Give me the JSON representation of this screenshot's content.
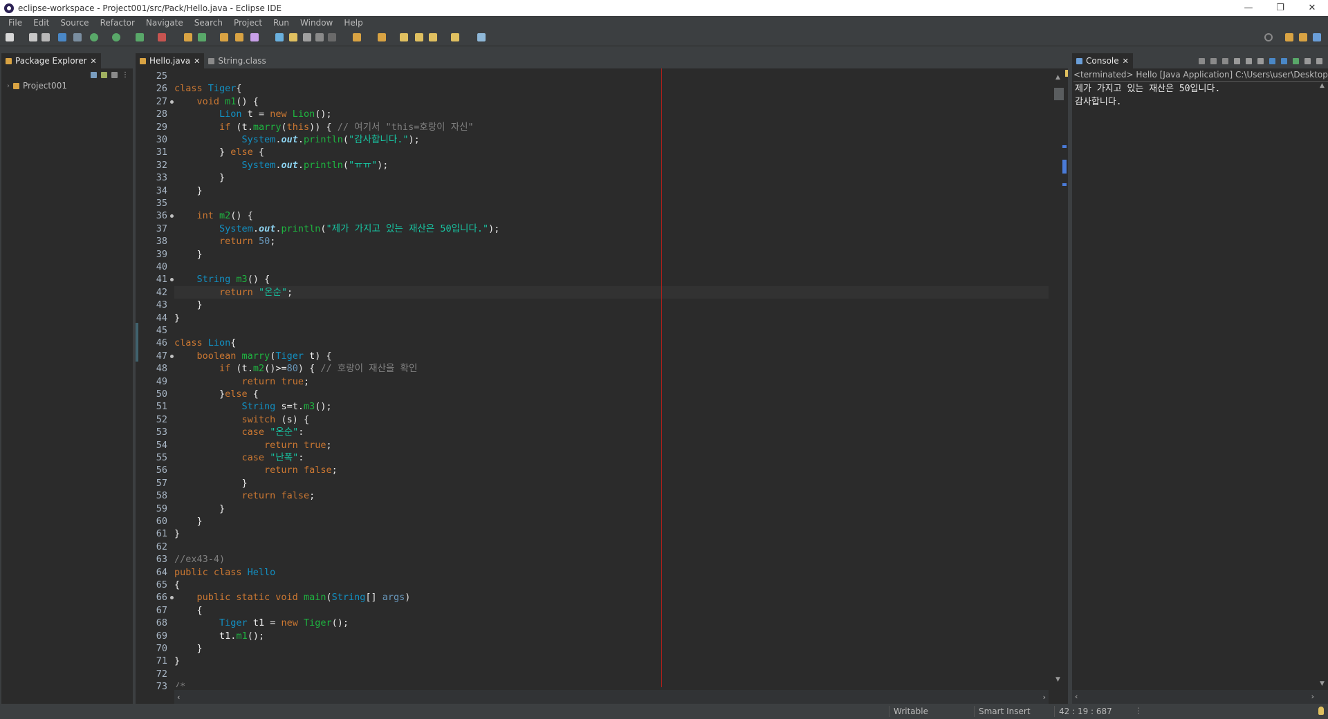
{
  "window": {
    "title": "eclipse-workspace - Project001/src/Pack/Hello.java - Eclipse IDE",
    "minimize": "—",
    "restore": "❐",
    "close": "✕"
  },
  "menu": [
    "File",
    "Edit",
    "Source",
    "Refactor",
    "Navigate",
    "Search",
    "Project",
    "Run",
    "Window",
    "Help"
  ],
  "package_explorer": {
    "tab_label": "Package Explorer",
    "tree": [
      {
        "label": "Project001",
        "expanded": false
      }
    ]
  },
  "editor": {
    "tabs": [
      {
        "label": "Hello.java",
        "active": true
      },
      {
        "label": "String.class",
        "active": false
      }
    ],
    "current_line": 42,
    "folded_markers": [
      27,
      36,
      41,
      47,
      66
    ],
    "lines": [
      {
        "n": 25,
        "tokens": []
      },
      {
        "n": 26,
        "tokens": [
          [
            "kw",
            "class "
          ],
          [
            "ty",
            "Tiger"
          ],
          [
            "pl",
            "{"
          ]
        ]
      },
      {
        "n": 27,
        "tokens": [
          [
            "pl",
            "    "
          ],
          [
            "kw",
            "void "
          ],
          [
            "fn",
            "m1"
          ],
          [
            "pl",
            "() {"
          ]
        ]
      },
      {
        "n": 28,
        "tokens": [
          [
            "pl",
            "        "
          ],
          [
            "ty",
            "Lion "
          ],
          [
            "id",
            "t"
          ],
          [
            "pl",
            " = "
          ],
          [
            "kw",
            "new "
          ],
          [
            "fn",
            "Lion"
          ],
          [
            "pl",
            "();"
          ]
        ]
      },
      {
        "n": 29,
        "tokens": [
          [
            "pl",
            "        "
          ],
          [
            "kw",
            "if "
          ],
          [
            "pl",
            "("
          ],
          [
            "id",
            "t"
          ],
          [
            "pl",
            "."
          ],
          [
            "fn",
            "marry"
          ],
          [
            "pl",
            "("
          ],
          [
            "kw",
            "this"
          ],
          [
            "pl",
            ")) { "
          ],
          [
            "cm",
            "// 여기서 \"this=호랑이 자신\""
          ]
        ]
      },
      {
        "n": 30,
        "tokens": [
          [
            "pl",
            "            "
          ],
          [
            "ty",
            "System"
          ],
          [
            "pl",
            "."
          ],
          [
            "fl",
            "out"
          ],
          [
            "pl",
            "."
          ],
          [
            "fn",
            "println"
          ],
          [
            "pl",
            "("
          ],
          [
            "st",
            "\"감사합니다.\""
          ],
          [
            "pl",
            ");"
          ]
        ]
      },
      {
        "n": 31,
        "tokens": [
          [
            "pl",
            "        } "
          ],
          [
            "kw",
            "else "
          ],
          [
            "pl",
            "{"
          ]
        ]
      },
      {
        "n": 32,
        "tokens": [
          [
            "pl",
            "            "
          ],
          [
            "ty",
            "System"
          ],
          [
            "pl",
            "."
          ],
          [
            "fl",
            "out"
          ],
          [
            "pl",
            "."
          ],
          [
            "fn",
            "println"
          ],
          [
            "pl",
            "("
          ],
          [
            "st",
            "\"ㅠㅠ\""
          ],
          [
            "pl",
            ");"
          ]
        ]
      },
      {
        "n": 33,
        "tokens": [
          [
            "pl",
            "        }"
          ]
        ]
      },
      {
        "n": 34,
        "tokens": [
          [
            "pl",
            "    }"
          ]
        ]
      },
      {
        "n": 35,
        "tokens": []
      },
      {
        "n": 36,
        "tokens": [
          [
            "pl",
            "    "
          ],
          [
            "kw",
            "int "
          ],
          [
            "fn",
            "m2"
          ],
          [
            "pl",
            "() {"
          ]
        ]
      },
      {
        "n": 37,
        "tokens": [
          [
            "pl",
            "        "
          ],
          [
            "ty",
            "System"
          ],
          [
            "pl",
            "."
          ],
          [
            "fl",
            "out"
          ],
          [
            "pl",
            "."
          ],
          [
            "fn",
            "println"
          ],
          [
            "pl",
            "("
          ],
          [
            "st",
            "\"제가 가지고 있는 재산은 50입니다.\""
          ],
          [
            "pl",
            ");"
          ]
        ]
      },
      {
        "n": 38,
        "tokens": [
          [
            "pl",
            "        "
          ],
          [
            "kw",
            "return "
          ],
          [
            "nm",
            "50"
          ],
          [
            "pl",
            ";"
          ]
        ]
      },
      {
        "n": 39,
        "tokens": [
          [
            "pl",
            "    }"
          ]
        ]
      },
      {
        "n": 40,
        "tokens": []
      },
      {
        "n": 41,
        "tokens": [
          [
            "pl",
            "    "
          ],
          [
            "ty",
            "String "
          ],
          [
            "fn",
            "m3"
          ],
          [
            "pl",
            "() {"
          ]
        ]
      },
      {
        "n": 42,
        "tokens": [
          [
            "pl",
            "        "
          ],
          [
            "kw",
            "return "
          ],
          [
            "st",
            "\"온순\""
          ],
          [
            "pl",
            ";"
          ]
        ]
      },
      {
        "n": 43,
        "tokens": [
          [
            "pl",
            "    }"
          ]
        ]
      },
      {
        "n": 44,
        "tokens": [
          [
            "pl",
            "}"
          ]
        ]
      },
      {
        "n": 45,
        "tokens": []
      },
      {
        "n": 46,
        "tokens": [
          [
            "kw",
            "class "
          ],
          [
            "ty",
            "Lion"
          ],
          [
            "pl",
            "{"
          ]
        ]
      },
      {
        "n": 47,
        "tokens": [
          [
            "pl",
            "    "
          ],
          [
            "kw",
            "boolean "
          ],
          [
            "fn",
            "marry"
          ],
          [
            "pl",
            "("
          ],
          [
            "ty",
            "Tiger "
          ],
          [
            "id",
            "t"
          ],
          [
            "pl",
            ") {"
          ]
        ]
      },
      {
        "n": 48,
        "tokens": [
          [
            "pl",
            "        "
          ],
          [
            "kw",
            "if "
          ],
          [
            "pl",
            "("
          ],
          [
            "id",
            "t"
          ],
          [
            "pl",
            "."
          ],
          [
            "fn",
            "m2"
          ],
          [
            "pl",
            "()>="
          ],
          [
            "nm",
            "80"
          ],
          [
            "pl",
            ") { "
          ],
          [
            "cm",
            "// 호랑이 재산을 확인"
          ]
        ]
      },
      {
        "n": 49,
        "tokens": [
          [
            "pl",
            "            "
          ],
          [
            "kw",
            "return true"
          ],
          [
            "pl",
            ";"
          ]
        ]
      },
      {
        "n": 50,
        "tokens": [
          [
            "pl",
            "        }"
          ],
          [
            "kw",
            "else "
          ],
          [
            "pl",
            "{"
          ]
        ]
      },
      {
        "n": 51,
        "tokens": [
          [
            "pl",
            "            "
          ],
          [
            "ty",
            "String "
          ],
          [
            "id",
            "s"
          ],
          [
            "pl",
            "="
          ],
          [
            "id",
            "t"
          ],
          [
            "pl",
            "."
          ],
          [
            "fn",
            "m3"
          ],
          [
            "pl",
            "();"
          ]
        ]
      },
      {
        "n": 52,
        "tokens": [
          [
            "pl",
            "            "
          ],
          [
            "kw",
            "switch "
          ],
          [
            "pl",
            "("
          ],
          [
            "id",
            "s"
          ],
          [
            "pl",
            ") {"
          ]
        ]
      },
      {
        "n": 53,
        "tokens": [
          [
            "pl",
            "            "
          ],
          [
            "kw",
            "case "
          ],
          [
            "st",
            "\"온순\""
          ],
          [
            "pl",
            ":"
          ]
        ]
      },
      {
        "n": 54,
        "tokens": [
          [
            "pl",
            "                "
          ],
          [
            "kw",
            "return true"
          ],
          [
            "pl",
            ";"
          ]
        ]
      },
      {
        "n": 55,
        "tokens": [
          [
            "pl",
            "            "
          ],
          [
            "kw",
            "case "
          ],
          [
            "st",
            "\"난폭\""
          ],
          [
            "pl",
            ":"
          ]
        ]
      },
      {
        "n": 56,
        "tokens": [
          [
            "pl",
            "                "
          ],
          [
            "kw",
            "return false"
          ],
          [
            "pl",
            ";"
          ]
        ]
      },
      {
        "n": 57,
        "tokens": [
          [
            "pl",
            "            }"
          ]
        ]
      },
      {
        "n": 58,
        "tokens": [
          [
            "pl",
            "            "
          ],
          [
            "kw",
            "return false"
          ],
          [
            "pl",
            ";"
          ]
        ]
      },
      {
        "n": 59,
        "tokens": [
          [
            "pl",
            "        }"
          ]
        ]
      },
      {
        "n": 60,
        "tokens": [
          [
            "pl",
            "    }"
          ]
        ]
      },
      {
        "n": 61,
        "tokens": [
          [
            "pl",
            "}"
          ]
        ]
      },
      {
        "n": 62,
        "tokens": []
      },
      {
        "n": 63,
        "tokens": [
          [
            "cm",
            "//ex43-4)"
          ]
        ]
      },
      {
        "n": 64,
        "tokens": [
          [
            "kw",
            "public class "
          ],
          [
            "ty",
            "Hello"
          ]
        ]
      },
      {
        "n": 65,
        "tokens": [
          [
            "pl",
            "{"
          ]
        ]
      },
      {
        "n": 66,
        "tokens": [
          [
            "pl",
            "    "
          ],
          [
            "kw",
            "public static void "
          ],
          [
            "fn",
            "main"
          ],
          [
            "pl",
            "("
          ],
          [
            "ty",
            "String"
          ],
          [
            "pl",
            "[] "
          ],
          [
            "nm",
            "args"
          ],
          [
            "pl",
            ")"
          ]
        ]
      },
      {
        "n": 67,
        "tokens": [
          [
            "pl",
            "    {"
          ]
        ]
      },
      {
        "n": 68,
        "tokens": [
          [
            "pl",
            "        "
          ],
          [
            "ty",
            "Tiger "
          ],
          [
            "id",
            "t1"
          ],
          [
            "pl",
            " = "
          ],
          [
            "kw",
            "new "
          ],
          [
            "fn",
            "Tiger"
          ],
          [
            "pl",
            "();"
          ]
        ]
      },
      {
        "n": 69,
        "tokens": [
          [
            "pl",
            "        "
          ],
          [
            "id",
            "t1"
          ],
          [
            "pl",
            "."
          ],
          [
            "fn",
            "m1"
          ],
          [
            "pl",
            "();"
          ]
        ]
      },
      {
        "n": 70,
        "tokens": [
          [
            "pl",
            "    }"
          ]
        ]
      },
      {
        "n": 71,
        "tokens": [
          [
            "pl",
            "}"
          ]
        ]
      },
      {
        "n": 72,
        "tokens": []
      },
      {
        "n": 73,
        "tokens": [
          [
            "cm",
            "/*"
          ]
        ]
      }
    ]
  },
  "console": {
    "tab_label": "Console",
    "path": "<terminated> Hello [Java Application] C:\\Users\\user\\Desktop\\ec",
    "output": [
      "제가 가지고 있는 재산은 50입니다.",
      "감사합니다."
    ]
  },
  "status": {
    "writable": "Writable",
    "insert_mode": "Smart Insert",
    "position": "42 : 19 : 687"
  },
  "colors": {
    "editor_bg": "#2b2b2b",
    "panel_bg": "#3c3f41",
    "keyword": "#cc7832",
    "type": "#1290c3",
    "string": "#17c6a3",
    "comment": "#808080",
    "margin_line": "#b0201a"
  }
}
